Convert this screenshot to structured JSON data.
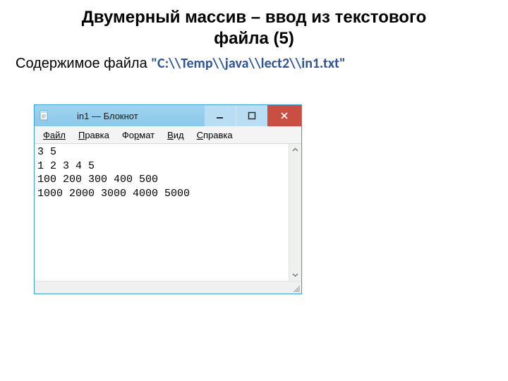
{
  "title_line1": "Двумерный массив – ввод из текстового",
  "title_line2": "файла (5)",
  "subtitle_prefix": "Содержимое файла ",
  "file_path": "\"C:\\\\Temp\\\\java\\\\lect2\\\\in1.txt\"",
  "window": {
    "title": "in1 — Блокнот",
    "menu": {
      "file": "Файл",
      "edit": {
        "u": "П",
        "rest": "равка"
      },
      "format": {
        "pre": "Фо",
        "u": "р",
        "rest": "мат"
      },
      "view": {
        "u": "В",
        "rest": "ид"
      },
      "help": {
        "u": "С",
        "rest": "правка"
      }
    },
    "content": "3 5\n1 2 3 4 5\n100 200 300 400 500\n1000 2000 3000 4000 5000"
  }
}
